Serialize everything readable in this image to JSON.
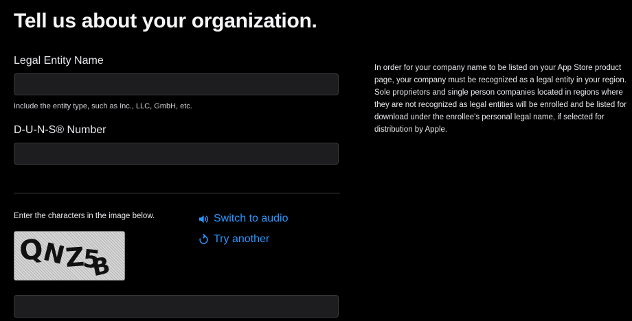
{
  "page": {
    "title": "Tell us about your organization."
  },
  "legal_entity": {
    "label": "Legal Entity Name",
    "value": "",
    "hint": "Include the entity type, such as Inc., LLC, GmbH, etc."
  },
  "duns": {
    "label": "D-U-N-S® Number",
    "value": ""
  },
  "captcha": {
    "prompt": "Enter the characters in the image below.",
    "image_text": "QNZ5B",
    "switch_audio_label": "Switch to audio",
    "try_another_label": "Try another",
    "input_value": "",
    "speaker_icon": "speaker-icon",
    "refresh_icon": "refresh-icon"
  },
  "info": {
    "text": "In order for your company name to be listed on your App Store product page, your company must be recognized as a legal entity in your region. Sole proprietors and single person companies located in regions where they are not recognized as legal entities will be enrolled and be listed for download under the enrollee's personal legal name, if selected for distribution by Apple."
  },
  "colors": {
    "background": "#000000",
    "text": "#f5f5f7",
    "link": "#2997ff",
    "input_background": "#1d1d1f",
    "input_border": "#3a3a3c"
  }
}
